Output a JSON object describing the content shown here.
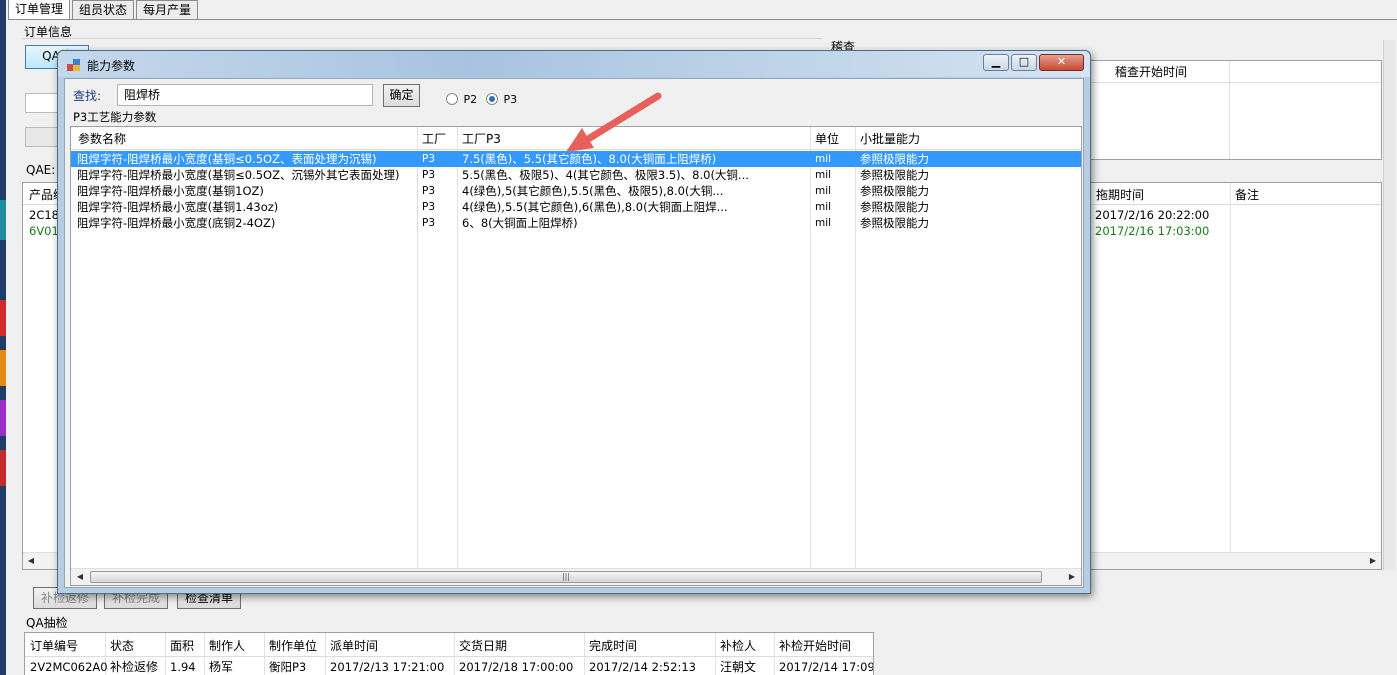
{
  "tabs": [
    "订单管理",
    "组员状态",
    "每月产量"
  ],
  "order_info": {
    "group_title": "订单信息",
    "qa_button": "QA检"
  },
  "qae_label": "QAE:",
  "audit": {
    "group_title": "稽查",
    "headers": [
      "稽查开始时间"
    ]
  },
  "products": {
    "first_header": "产品编",
    "rows": [
      {
        "code": "2C18",
        "pull_time": "2017/2/16 20:22:00",
        "color": "#000000"
      },
      {
        "code": "6V01",
        "pull_time": "2017/2/16 17:03:00",
        "color": "#1a7a1a"
      }
    ],
    "right_headers": [
      "拖期时间",
      "备注"
    ]
  },
  "bottom_buttons": [
    "补检返修",
    "补检完成",
    "检查清单"
  ],
  "qa_sampling": {
    "group_title": "QA抽检",
    "headers": [
      "订单编号",
      "状态",
      "面积",
      "制作人",
      "制作单位",
      "派单时间",
      "交货日期",
      "完成时间",
      "补检人",
      "补检开始时间"
    ],
    "rows": [
      [
        "2V2MC062A0",
        "补检返修",
        "1.94",
        "杨军",
        "衡阳P3",
        "2017/2/13 17:21:00",
        "2017/2/18 17:00:00",
        "2017/2/14 2:52:13",
        "汪朝文",
        "2017/2/14 17:09"
      ]
    ]
  },
  "dialog": {
    "title": "能力参数",
    "search_label": "查找:",
    "search_value": "阻焊桥",
    "confirm_button": "确定",
    "radio_p2": "P2",
    "radio_p3": "P3",
    "selected_radio": "P3",
    "section_label": "P3工艺能力参数",
    "columns": [
      "参数名称",
      "工厂",
      "工厂P3",
      "单位",
      "小批量能力"
    ],
    "rows": [
      [
        "阻焊字符-阻焊桥最小宽度(基铜≤0.5OZ、表面处理为沉锡)",
        "P3",
        "7.5(黑色)、5.5(其它颜色)、8.0(大铜面上阻焊桥)",
        "mil",
        "参照极限能力"
      ],
      [
        "阻焊字符-阻焊桥最小宽度(基铜≤0.5OZ、沉锡外其它表面处理)",
        "P3",
        "5.5(黑色、极限5)、4(其它颜色、极限3.5)、8.0(大铜...",
        "mil",
        "参照极限能力"
      ],
      [
        "阻焊字符-阻焊桥最小宽度(基铜1OZ)",
        "P3",
        "4(绿色),5(其它颜色),5.5(黑色、极限5),8.0(大铜...",
        "mil",
        "参照极限能力"
      ],
      [
        "阻焊字符-阻焊桥最小宽度(基铜1.43oz)",
        "P3",
        "4(绿色),5.5(其它颜色),6(黑色),8.0(大铜面上阻焊...",
        "mil",
        "参照极限能力"
      ],
      [
        "阻焊字符-阻焊桥最小宽度(底铜2-4OZ)",
        "P3",
        "6、8(大铜面上阻焊桥)",
        "mil",
        "参照极限能力"
      ]
    ],
    "selected_row": 0
  },
  "colors": {
    "selection": "#3399ff",
    "arrow": "#e8605a",
    "accent_green": "#1a7a1a"
  },
  "icons": [
    "app-icon",
    "minimize-icon",
    "maximize-icon",
    "close-icon",
    "arrow-annotation-icon"
  ]
}
